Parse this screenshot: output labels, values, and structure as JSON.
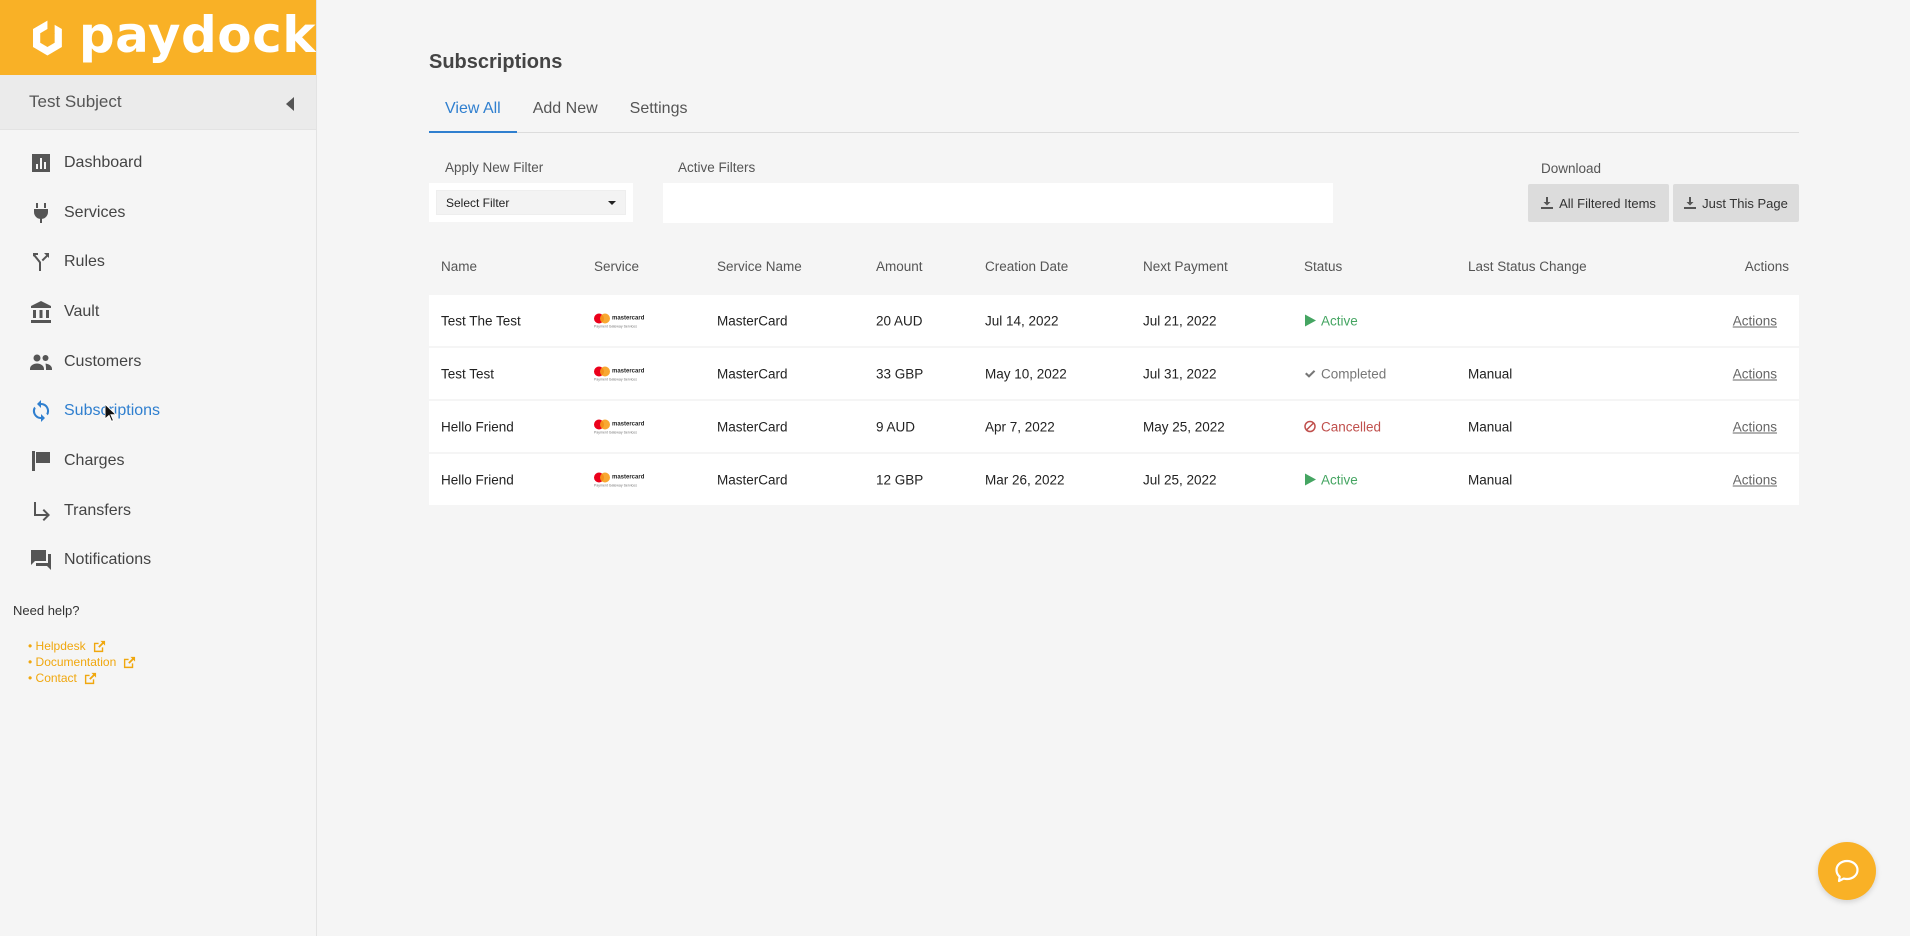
{
  "brand": {
    "name": "paydock",
    "color": "#f9b126"
  },
  "account": {
    "name": "Test Subject"
  },
  "sidebar": {
    "active_color": "#2f7fcf",
    "items": [
      {
        "label": "Dashboard",
        "icon": "bar-chart-icon",
        "active": false
      },
      {
        "label": "Services",
        "icon": "plug-icon",
        "active": false
      },
      {
        "label": "Rules",
        "icon": "fork-icon",
        "active": false
      },
      {
        "label": "Vault",
        "icon": "bank-icon",
        "active": false
      },
      {
        "label": "Customers",
        "icon": "people-icon",
        "active": false
      },
      {
        "label": "Subscriptions",
        "icon": "refresh-icon",
        "active": true
      },
      {
        "label": "Charges",
        "icon": "flag-icon",
        "active": false
      },
      {
        "label": "Transfers",
        "icon": "arrow-turn-right-icon",
        "active": false
      },
      {
        "label": "Notifications",
        "icon": "chat-icon",
        "active": false
      }
    ],
    "help": {
      "title": "Need help?",
      "links": [
        {
          "label": "• Helpdesk",
          "icon": "external-link-icon"
        },
        {
          "label": "• Documentation",
          "icon": "external-link-icon"
        },
        {
          "label": "• Contact",
          "icon": "external-link-icon"
        }
      ]
    }
  },
  "page": {
    "title": "Subscriptions",
    "tabs": [
      {
        "label": "View All",
        "active": true
      },
      {
        "label": "Add New",
        "active": false
      },
      {
        "label": "Settings",
        "active": false
      }
    ],
    "filter": {
      "apply_label": "Apply New Filter",
      "select_value": "Select Filter",
      "active_label": "Active Filters"
    },
    "download": {
      "label": "Download",
      "all_button": "All Filtered Items",
      "page_button": "Just This Page"
    }
  },
  "table": {
    "columns": [
      "Name",
      "Service",
      "Service Name",
      "Amount",
      "Creation Date",
      "Next Payment",
      "Status",
      "Last Status Change",
      "Actions"
    ],
    "service_logo": {
      "word": "mastercard",
      "sub": "Payment Gateway Services"
    },
    "rows": [
      {
        "name": "Test The Test",
        "service_name": "MasterCard",
        "amount": "20 AUD",
        "creation_date": "Jul 14, 2022",
        "next_payment": "Jul 21, 2022",
        "status": "Active",
        "status_type": "active",
        "last_status_change": "",
        "actions": "Actions"
      },
      {
        "name": "Test Test",
        "service_name": "MasterCard",
        "amount": "33 GBP",
        "creation_date": "May 10, 2022",
        "next_payment": "Jul 31, 2022",
        "status": "Completed",
        "status_type": "completed",
        "last_status_change": "Manual",
        "actions": "Actions"
      },
      {
        "name": "Hello Friend",
        "service_name": "MasterCard",
        "amount": "9 AUD",
        "creation_date": "Apr 7, 2022",
        "next_payment": "May 25, 2022",
        "status": "Cancelled",
        "status_type": "cancelled",
        "last_status_change": "Manual",
        "actions": "Actions"
      },
      {
        "name": "Hello Friend",
        "service_name": "MasterCard",
        "amount": "12 GBP",
        "creation_date": "Mar 26, 2022",
        "next_payment": "Jul 25, 2022",
        "status": "Active",
        "status_type": "active",
        "last_status_change": "Manual",
        "actions": "Actions"
      }
    ]
  },
  "status_colors": {
    "active": "#45a562",
    "completed": "#777777",
    "cancelled": "#c0504d"
  }
}
